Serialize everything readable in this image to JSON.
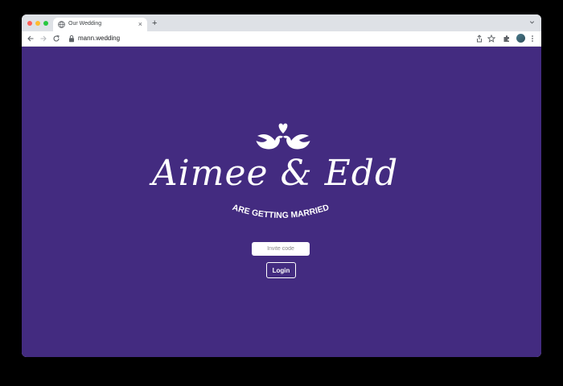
{
  "browser": {
    "tab": {
      "title": "Our Wedding",
      "close_glyph": "×",
      "favicon": "globe-icon"
    },
    "new_tab_glyph": "+",
    "address": {
      "url": "mann.wedding"
    }
  },
  "page": {
    "names": "Aimee & Edd",
    "tagline": "ARE GETTING MARRIED",
    "invite_input": {
      "placeholder": "Invite code",
      "value": ""
    },
    "login_label": "Login"
  },
  "colors": {
    "background": "#432b80",
    "text": "#ffffff",
    "input_bg": "#ffffff"
  }
}
